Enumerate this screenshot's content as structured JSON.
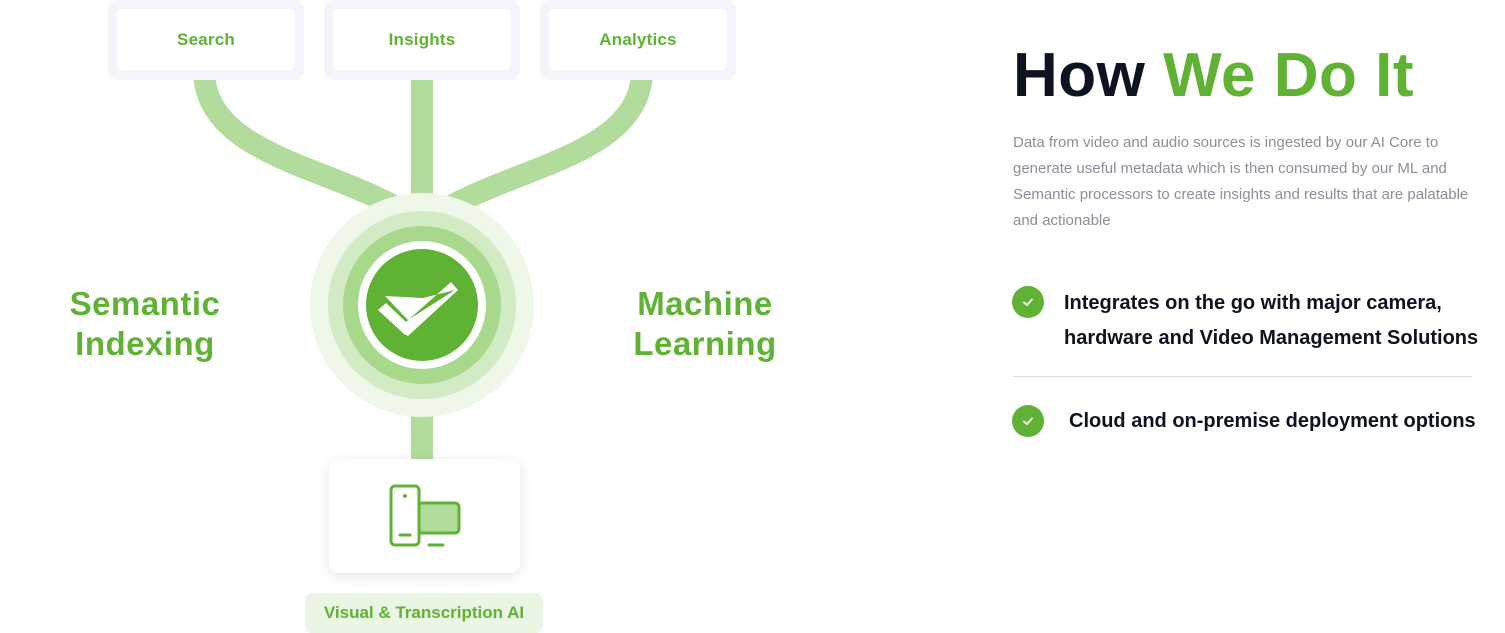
{
  "diagram": {
    "top_nodes": [
      "Search",
      "Insights",
      "Analytics"
    ],
    "left_label": "Semantic\nIndexing",
    "right_label": "Machine\nLearning",
    "center_icon": "check-logo-icon",
    "bottom_icon": "devices-icon",
    "bottom_caption": "Visual & Transcription AI"
  },
  "section": {
    "title_part1": "How",
    "title_part2": "We Do It",
    "description": "Data from video and audio sources is ingested by our AI Core to generate useful metadata which is then consumed by our ML and Semantic processors to create insights and results that are palatable and actionable",
    "features": [
      "Integrates on the go with major camera, hardware and Video Management Solutions",
      "Cloud and on-premise deployment options"
    ]
  },
  "colors": {
    "accent": "#5fb234",
    "accent_light": "#b2dc9c",
    "heading": "#0e1322",
    "body_text": "#8a8f99"
  }
}
